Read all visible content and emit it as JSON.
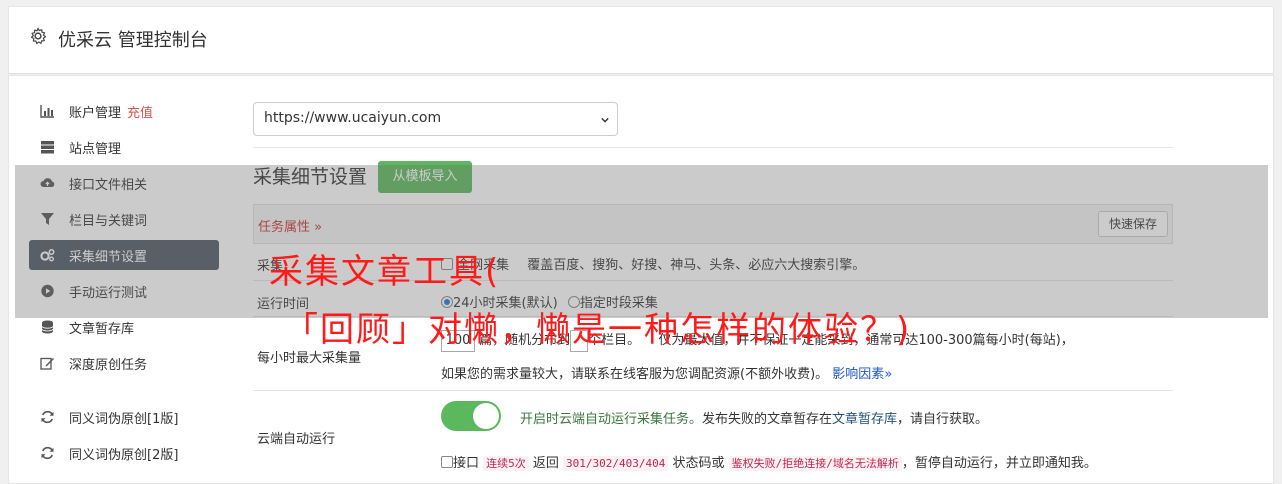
{
  "header": {
    "title": "优采云 管理控制台",
    "icon": "gear-icon"
  },
  "sidebar": {
    "items": [
      {
        "label": "账户管理",
        "extra": "充值",
        "icon": "bar-chart-icon"
      },
      {
        "label": "站点管理",
        "icon": "server-icon"
      },
      {
        "label": "接口文件相关",
        "icon": "cloud-upload-icon"
      },
      {
        "label": "栏目与关键词",
        "icon": "filter-icon"
      },
      {
        "label": "采集细节设置",
        "icon": "cogs-icon",
        "active": true
      },
      {
        "label": "手动运行测试",
        "icon": "play-circle-icon"
      },
      {
        "label": "文章暂存库",
        "icon": "database-icon"
      },
      {
        "label": "深度原创任务",
        "icon": "edit-icon"
      }
    ],
    "items2": [
      {
        "label": "同义词伪原创[1版]",
        "icon": "refresh-icon"
      },
      {
        "label": "同义词伪原创[2版]",
        "icon": "refresh-icon"
      }
    ]
  },
  "main": {
    "site_select": "https://www.ucaiyun.com",
    "section_title": "采集细节设置",
    "import_button": "从模板导入",
    "task_tab": "任务属性 ",
    "quick_save": "快速保存",
    "rows": {
      "scope": {
        "label": "采集",
        "checkbox_label": "全网采集",
        "desc": "覆盖百度、搜狗、好搜、神马、头条、必应六大搜索引擎。"
      },
      "time": {
        "label": "运行时间",
        "opt1": "24小时采集(默认)",
        "opt2": "指定时段采集"
      },
      "max": {
        "label": "每小时最大采集量",
        "value": "100",
        "desc1a": "篇，随机分布到",
        "desc1b": "个栏目。",
        "desc1c": "仅为最大值，并不保证一定能采到，通常可达100-300篇每小时(每站)，",
        "desc2": "如果您的需求量较大，请联系在线客服为您调配资源(不额外收费)。",
        "factors": "影响因素"
      },
      "cloud": {
        "label": "云端自动运行",
        "desc_green": "开启时云端自动运行采集任务。",
        "desc_a": "发布失败的文章暂存在",
        "desc_link": "文章暂存库",
        "desc_b": "，请自行获取。"
      },
      "api": {
        "checkbox": "接口",
        "c1": "连续5次",
        "t1": " 返回 ",
        "c2": "301/302/403/404",
        "t2": " 状态码或 ",
        "c3": "鉴权失败/拒绝连接/域名无法解析",
        "t3": "，暂停自动运行，并立即通知我。"
      }
    }
  },
  "watermark": {
    "line1": "采集文章工具(",
    "line2": "「回顾」对懒，懒是一种怎样的体验？)"
  },
  "colors": {
    "accent_green": "#5cb85c",
    "active_nav": "#4d5663",
    "watermark": "#ff1a1a",
    "danger": "#d9534f"
  }
}
